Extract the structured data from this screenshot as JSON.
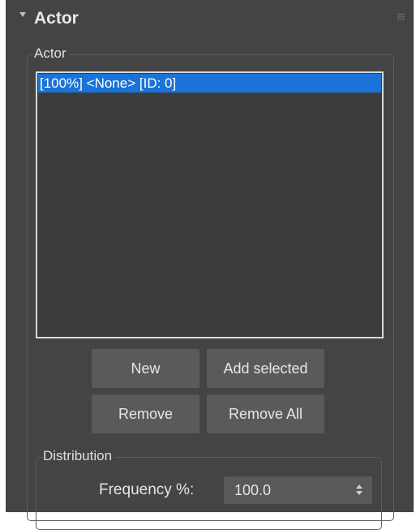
{
  "rollout": {
    "title": "Actor"
  },
  "actor_group": {
    "label": "Actor",
    "list_items": [
      {
        "text": "[100%] <None> [ID: 0]",
        "selected": true
      }
    ]
  },
  "buttons": {
    "new": "New",
    "add_selected": "Add selected",
    "remove": "Remove",
    "remove_all": "Remove All"
  },
  "distribution": {
    "label": "Distribution",
    "frequency_label": "Frequency %:",
    "frequency_value": "100.0"
  },
  "colors": {
    "panel_bg": "#444444",
    "selection": "#1a73d6",
    "button_bg": "#5a5a5a"
  },
  "icons": [
    "collapse-arrow-icon",
    "grip-icon",
    "spinner-arrows-icon"
  ]
}
